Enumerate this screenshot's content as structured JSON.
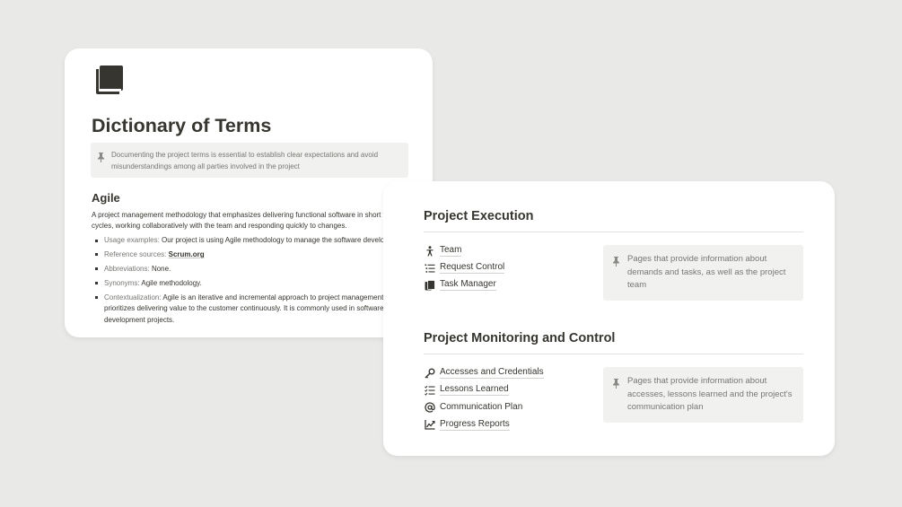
{
  "colors": {
    "background": "#e9e9e8",
    "card": "#ffffff",
    "text": "#37352f",
    "muted": "#787774",
    "callout_bg": "#f1f1ef"
  },
  "dictionary": {
    "icon": "book-icon",
    "title": "Dictionary of Terms",
    "callout": {
      "icon": "pin-icon",
      "text": "Documenting the project terms is essential to establish clear expectations and avoid misunderstandings among all parties involved in the project"
    },
    "agile": {
      "heading": "Agile",
      "desc_line1": "A project management methodology that emphasizes delivering functional software in short t",
      "desc_line2": "cycles, working collaboratively with the team and responding quickly to changes.",
      "items": [
        {
          "label": "Usage examples:",
          "value": "Our project is using Agile methodology to manage the software develo"
        },
        {
          "label": "Reference sources:",
          "value": "Scrum.org"
        },
        {
          "label": "Abbreviations:",
          "value": "None."
        },
        {
          "label": "Synonyms:",
          "value": "Agile methodology."
        },
        {
          "label": "Contextualization:",
          "value": "Agile is an iterative and incremental approach to project management",
          "line2": "prioritizes delivering value to the customer continuously. It is commonly used in software",
          "line3": "development projects."
        }
      ]
    }
  },
  "project": {
    "execution": {
      "title": "Project Execution",
      "links": [
        {
          "label": "Team",
          "icon": "person-icon"
        },
        {
          "label": "Request Control",
          "icon": "list-icon"
        },
        {
          "label": "Task Manager",
          "icon": "clipboard-icon"
        }
      ],
      "callout": {
        "icon": "pin-icon",
        "text": "Pages that provide information about demands and tasks, as well as the project team"
      }
    },
    "monitoring": {
      "title": "Project Monitoring and Control",
      "links": [
        {
          "label": "Accesses and Credentials",
          "icon": "key-icon"
        },
        {
          "label": "Lessons Learned",
          "icon": "checklist-icon"
        },
        {
          "label": "Communication Plan",
          "icon": "at-icon"
        },
        {
          "label": "Progress Reports",
          "icon": "chart-icon"
        }
      ],
      "callout": {
        "icon": "pin-icon",
        "text": "Pages that provide information about accesses, lessons learned and the project's communication plan"
      }
    }
  }
}
